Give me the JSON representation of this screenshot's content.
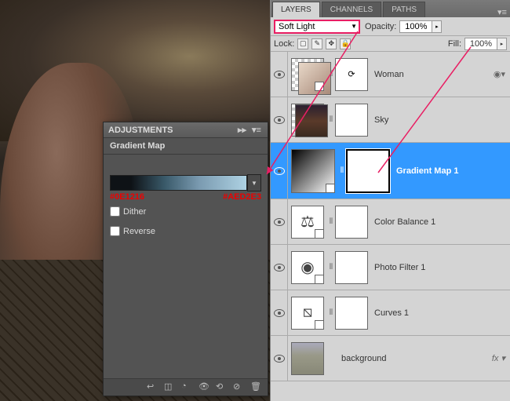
{
  "adjustments": {
    "panel_title": "ADJUSTMENTS",
    "adjustment_name": "Gradient Map",
    "hex_left": "#0E1216",
    "hex_right": "#AED2E3",
    "dither_label": "Dither",
    "reverse_label": "Reverse"
  },
  "layers_panel": {
    "tabs": [
      "LAYERS",
      "CHANNELS",
      "PATHS"
    ],
    "active_tab": 0,
    "blend_mode": "Soft Light",
    "opacity_label": "Opacity:",
    "opacity_value": "100%",
    "lock_label": "Lock:",
    "fill_label": "Fill:",
    "fill_value": "100%",
    "layers": [
      {
        "name": "Woman"
      },
      {
        "name": "Sky"
      },
      {
        "name": "Gradient Map 1"
      },
      {
        "name": "Color Balance 1"
      },
      {
        "name": "Photo Filter 1"
      },
      {
        "name": "Curves 1"
      },
      {
        "name": "background"
      }
    ]
  }
}
